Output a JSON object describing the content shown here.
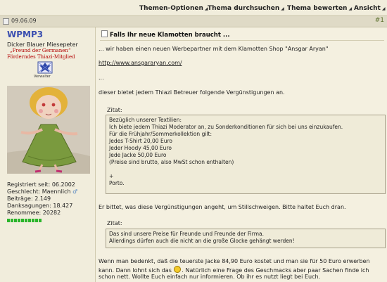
{
  "toolbar": {
    "thread_options": "Themen-Optionen",
    "search_thread": "Thema durchsuchen",
    "rate_thread": "Thema bewerten",
    "view": "Ansicht"
  },
  "post": {
    "date": "09.06.09",
    "number": "#1"
  },
  "user": {
    "name": "WPMP3",
    "title": "Dicker Blauer Miesepeter",
    "group_line1": "„Freund der Germanen“",
    "group_line2": "Förderndes Thiazi-Mitglied",
    "badge_label": "Verwalter",
    "registered": "Registriert seit: 06.2002",
    "gender": "Geschlecht: Maennlich",
    "posts": "Beiträge: 2.149",
    "thanks": "Danksagungen: 18.427",
    "renown": "Renommee: 20282",
    "rep_color": "#2cb52c"
  },
  "message": {
    "title": "Falls Ihr neue Klamotten braucht ...",
    "line1": "... wir haben einen neuen Werbepartner mit dem Klamotten Shop \"Ansgar Aryan\"",
    "url": "http://www.ansgararyan.com/",
    "dots": "...",
    "line2": "dieser bietet jedem Thiazi Betreuer folgende Vergünstigungen an.",
    "quote1_label": "Zitat:",
    "quote1": [
      "Bezüglich unserer Textilien:",
      "Ich biete jedem Thiazi Moderator an, zu Sonderkonditionen für sich bei uns einzukaufen.",
      "Für die Frühjahr/Sommerkollektion gilt:",
      "Jedes T-Shirt 20,00 Euro",
      "Jeder Hoody 45,00 Euro",
      "Jede Jacke 50,00 Euro",
      "(Preise sind brutto, also MwSt schon enthalten)",
      "",
      "+",
      "Porto."
    ],
    "line3": "Er bittet, was diese Vergünstigungen angeht, um Stillschweigen. Bitte haltet Euch dran.",
    "quote2_label": "Zitat:",
    "quote2": [
      "Das sind unsere Preise für Freunde und Freunde der Firma.",
      "Allerdings dürfen auch die nicht an die große Glocke gehängt werden!"
    ],
    "line4a": "Wenn man bedenkt, daß die teuerste Jacke 84,90 Euro kostet und man sie für 50 Euro erwerben",
    "line4b_pre": "kann. Dann lohnt sich das",
    "line4b_post": ". Natürlich eine Frage des Geschmacks aber paar Sachen finde ich",
    "line4c": "schon nett. Wollte Euch einfach nur informieren. Ob ihr es nutzt liegt bei Euch."
  }
}
